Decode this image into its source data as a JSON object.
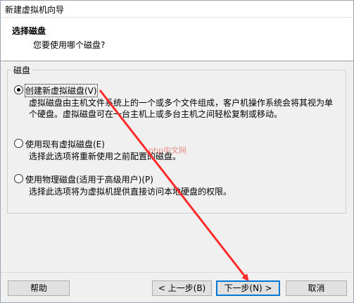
{
  "window": {
    "title": "新建虚拟机向导"
  },
  "header": {
    "title": "选择磁盘",
    "subtitle": "您要使用哪个磁盘?"
  },
  "group": {
    "label": "磁盘"
  },
  "options": [
    {
      "label": "创建新虚拟磁盘(V)",
      "checked": true,
      "desc": [
        "虚拟磁盘由主机文件系统上的一个或多个文件组成，客户机操作系统会将其视为单",
        "个硬盘。虚拟磁盘可在一台主机上或多台主机之间轻松复制或移动。"
      ]
    },
    {
      "label": "使用现有虚拟磁盘(E)",
      "checked": false,
      "desc": [
        "选择此选项将重新使用之前配置的磁盘。"
      ]
    },
    {
      "label": "使用物理磁盘(适用于高级用户)(P)",
      "checked": false,
      "desc": [
        "选择此选项将为虚拟机提供直接访问本地硬盘的权限。"
      ]
    }
  ],
  "buttons": {
    "help": "帮助",
    "back": "< 上一步(B)",
    "next": "下一步(N) >",
    "cancel": "取消"
  },
  "watermark": "php中文网",
  "annotation": {
    "color": "#ff2a2a"
  }
}
